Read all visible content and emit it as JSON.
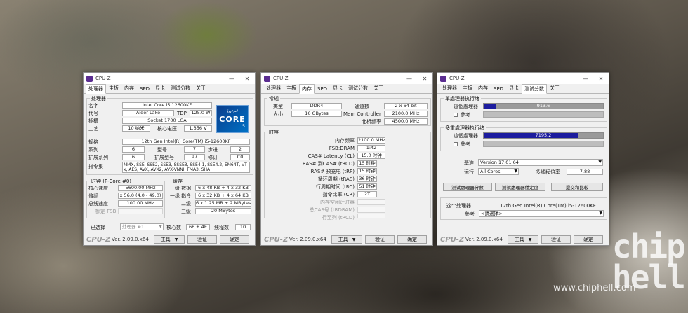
{
  "watermark": {
    "url": "www.chiphell.com",
    "logo": "chip hell"
  },
  "common": {
    "title": "CPU-Z",
    "minimize": "—",
    "close": "✕",
    "tabs": [
      "处理器",
      "主板",
      "内存",
      "SPD",
      "显卡",
      "测试分数",
      "关于"
    ],
    "brand": "CPU-Z",
    "version": "Ver. 2.09.0.x64",
    "tools": "工具",
    "validate": "验证",
    "ok": "确定"
  },
  "win1": {
    "active_tab": 0,
    "group_processor": "处理器",
    "name_label": "名字",
    "name": "Intel Core i5 12600KF",
    "codename_label": "代号",
    "codename": "Alder Lake",
    "tdp_label": "TDP",
    "tdp": "125.0 W",
    "package_label": "插槽",
    "package": "Socket 1700 LGA",
    "tech_label": "工艺",
    "tech": "10 纳米",
    "vcore_label": "核心电压",
    "vcore": "1.356 V",
    "intel_logo": {
      "l1": "intel",
      "l2": "CORE",
      "l3": "i5"
    },
    "spec_label": "规格",
    "spec": "12th Gen Intel(R) Core(TM) i5-12600KF",
    "family_label": "系列",
    "family": "6",
    "model_label": "型号",
    "model": "7",
    "stepping_label": "步进",
    "stepping": "2",
    "extfamily_label": "扩展系列",
    "extfamily": "6",
    "extmodel_label": "扩展型号",
    "extmodel": "97",
    "revision_label": "修订",
    "revision": "C0",
    "instr_label": "指令集",
    "instr": "MMX, SSE, SSE2, SSE3, SSSE3, SSE4.1, SSE4.2, EM64T, VT-x, AES, AVX, AVX2, AVX-VNNI, FMA3, SHA",
    "group_clocks": "时钟 (P-Core #0)",
    "corespeed_label": "核心速度",
    "corespeed": "5600.00 MHz",
    "mult_label": "倍频",
    "mult": "x 56.0 (4.0 - 49.0)",
    "bus_label": "总线速度",
    "bus": "100.00 MHz",
    "fsb_label": "额定 FSB",
    "group_cache": "缓存",
    "l1d_label": "一级 数据",
    "l1d": "6 x 48 KB + 4 x 32 KB",
    "l1i_label": "一级 指令",
    "l1i": "6 x 32 KB + 4 x 64 KB",
    "l2_label": "二级",
    "l2": "6 x 1.25 MB + 2 MBytes",
    "l3_label": "三级",
    "l3": "20 MBytes",
    "selected_label": "已选择",
    "selected": "处理器 #1",
    "cores_label": "核心数",
    "cores": "6P + 4E",
    "threads_label": "线程数",
    "threads": "10"
  },
  "win2": {
    "active_tab": 2,
    "group_general": "常规",
    "type_label": "类型",
    "type": "DDR4",
    "channels_label": "通道数",
    "channels": "2 x 64-bit",
    "size_label": "大小",
    "size": "16 GBytes",
    "memctrl_label": "Mem Controller",
    "memctrl": "2100.0 MHz",
    "nb_label": "北桥频率",
    "nb": "4500.0 MHz",
    "group_timings": "时序",
    "freq_label": "内存频率",
    "freq": "2100.0 MHz",
    "fsbdram_label": "FSB:DRAM",
    "fsbdram": "1:42",
    "cl_label": "CAS# Latency (CL)",
    "cl": "15.0 时钟",
    "trcd_label": "RAS# 到CAS# (tRCD)",
    "trcd": "15 时钟",
    "trp_label": "RAS# 预充电 (tRP)",
    "trp": "15 时钟",
    "tras_label": "循环周期 (tRAS)",
    "tras": "36 时钟",
    "trc_label": "行周期时间 (tRC)",
    "trc": "51 时钟",
    "cr_label": "指令比率 (CR)",
    "cr": "2T",
    "idle_label": "内存空闲计时器",
    "tcas_label": "总CAS号 (tRDRAM)",
    "trcd2_label": "行至列 (tRCD)"
  },
  "win3": {
    "active_tab": 5,
    "group_single": "單處理器执行绪",
    "this_cpu_label": "這個處理器",
    "single_score": "913.6",
    "single_fraction": 0.1,
    "ref_label": "參考",
    "group_multi": "多重處理器执行绪",
    "multi_score": "7195.2",
    "multi_fraction": 0.79,
    "bench_label": "基准",
    "bench": "Version 17.01.64",
    "threads_label": "运行",
    "threads": "All Cores",
    "ratio_label": "多线程倍率",
    "ratio": "7.88",
    "btn_bench": "测试處理器分數",
    "btn_stress": "测试處理器穩定度",
    "btn_submit": "提交和比較",
    "cpu_label": "这个处理器",
    "cpu": "12th Gen Intel(R) Core(TM) i5-12600KF",
    "ref2_label": "參考",
    "ref2": "<請選擇>"
  }
}
